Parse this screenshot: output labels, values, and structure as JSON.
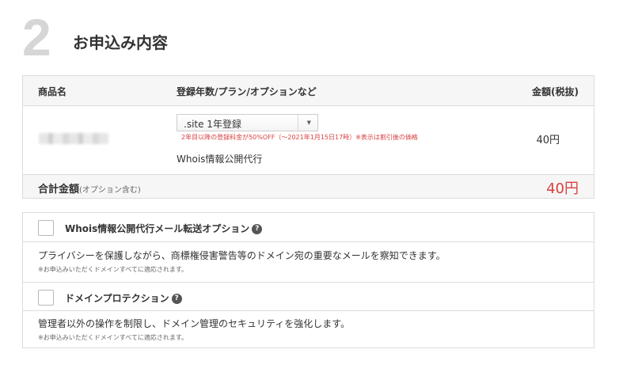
{
  "section": {
    "step": "2",
    "title": "お申込み内容"
  },
  "order_table": {
    "headers": {
      "product": "商品名",
      "plan": "登録年数/プラン/オプションなど",
      "price": "金額(税抜)"
    },
    "row": {
      "plan_select_value": ".site 1年登録",
      "discount_note": "2年目以降の登録料金が50%OFF（～2021年1月15日17時）※表示は割引後の価格",
      "whois_label": "Whois情報公開代行",
      "price": "40円"
    },
    "total": {
      "label": "合計金額",
      "note": "(オプション含む)",
      "value": "40円"
    }
  },
  "options": [
    {
      "title": "Whois情報公開代行メール転送オプション",
      "description": "プライバシーを保護しながら、商標権侵害警告等のドメイン宛の重要なメールを察知できます。",
      "note": "※お申込みいただくドメインすべてに適応されます。"
    },
    {
      "title": "ドメインプロテクション",
      "description": "管理者以外の操作を制限し、ドメイン管理のセキュリティを強化します。",
      "note": "※お申込みいただくドメインすべてに適応されます。"
    }
  ],
  "icons": {
    "help": "?",
    "select_caret": "▼"
  },
  "colors": {
    "accent_red": "#d94040",
    "step_gray": "#d6d6d6",
    "header_bg": "#f6f6f6",
    "border": "#dcdcdc"
  }
}
